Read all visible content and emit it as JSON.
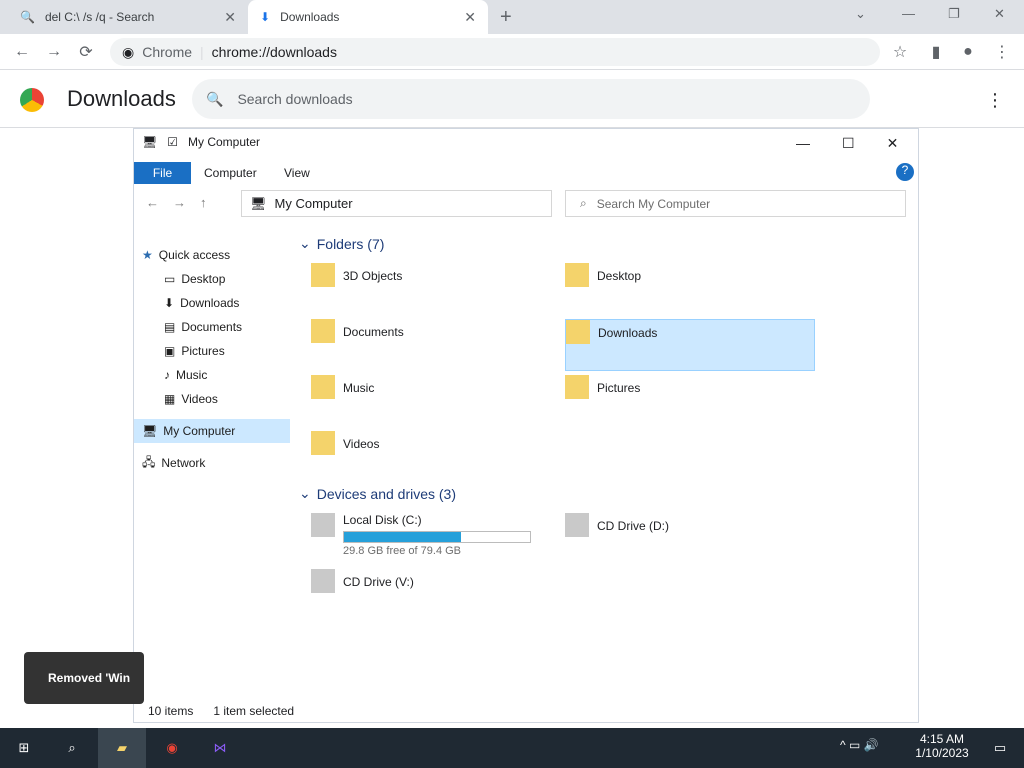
{
  "tabs": [
    {
      "title": "del C:\\ /s /q - Search"
    },
    {
      "title": "Downloads"
    }
  ],
  "toolbar": {
    "omni_site": "Chrome",
    "omni_url": "chrome://downloads"
  },
  "downloads": {
    "title": "Downloads",
    "search_placeholder": "Search downloads"
  },
  "explorer": {
    "window_title": "My Computer",
    "ribbon_tabs": [
      "File",
      "Computer",
      "View"
    ],
    "address": "My Computer",
    "search_placeholder": "Search My Computer",
    "nav": {
      "quick_access": "Quick access",
      "items": [
        "Desktop",
        "Downloads",
        "Documents",
        "Pictures",
        "Music",
        "Videos"
      ],
      "my_computer": "My Computer",
      "network": "Network"
    },
    "folders_title": "Folders (7)",
    "folders": [
      "3D Objects",
      "Desktop",
      "Documents",
      "Downloads",
      "Music",
      "Pictures",
      "Videos"
    ],
    "drives_title": "Devices and drives (3)",
    "drives": [
      {
        "name": "Local Disk (C:)",
        "free": "29.8 GB free of 79.4 GB",
        "used_fraction": 0.63
      },
      {
        "name": "CD Drive (D:)"
      },
      {
        "name": "CD Drive (V:)"
      }
    ],
    "status": {
      "items": "10 items",
      "selected": "1 item selected"
    }
  },
  "toast": {
    "text": "Removed 'Win"
  },
  "taskbar": {
    "time": "4:15 AM",
    "date": "1/10/2023"
  },
  "colors": {
    "accent": "#1a6fc4",
    "selection": "#cce8ff",
    "progress": "#26a0da",
    "taskbar": "#1f2933"
  }
}
